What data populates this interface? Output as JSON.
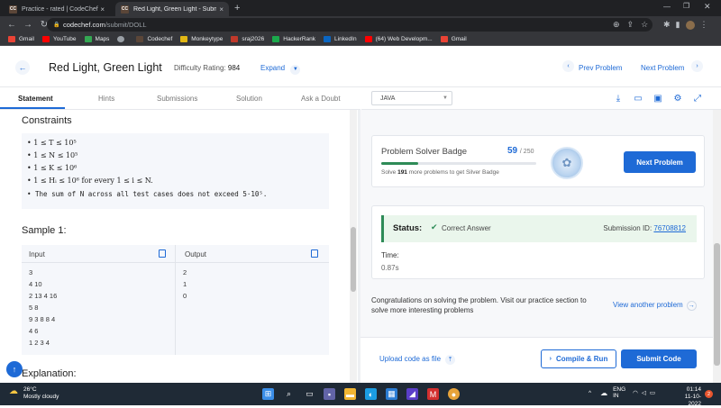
{
  "browser": {
    "tabs": [
      {
        "favicon": "CC",
        "title": "Practice - rated | CodeChef"
      },
      {
        "favicon": "CC",
        "title": "Red Light, Green Light - Submit |"
      }
    ],
    "url_domain": "codechef.com",
    "url_path": "/submit/DOLL",
    "bookmarks": [
      {
        "label": "Gmail",
        "color": "#ea4335"
      },
      {
        "label": "YouTube",
        "color": "#ff0000"
      },
      {
        "label": "Maps",
        "color": "#34a853"
      },
      {
        "label": "",
        "color": "#9aa0a6"
      },
      {
        "label": "Codechef",
        "color": "#5b4638"
      },
      {
        "label": "Monkeytype",
        "color": "#e2b714"
      },
      {
        "label": "sraj2026",
        "color": "#c0392b"
      },
      {
        "label": "HackerRank",
        "color": "#1ba94c"
      },
      {
        "label": "LinkedIn",
        "color": "#0a66c2"
      },
      {
        "label": "(64) Web Developm...",
        "color": "#ff0000"
      },
      {
        "label": "Gmail",
        "color": "#ea4335"
      }
    ]
  },
  "header": {
    "title": "Red Light, Green Light",
    "rating_label": "Difficulty Rating:",
    "rating_value": "984",
    "expand": "Expand",
    "prev": "Prev Problem",
    "next": "Next Problem"
  },
  "problem_tabs": [
    "Statement",
    "Hints",
    "Submissions",
    "Solution",
    "Ask a Doubt"
  ],
  "constraints": {
    "heading": "Constraints",
    "items": [
      "1 ≤ T ≤ 10⁵",
      "1 ≤ N ≤ 10⁵",
      "1 ≤ K ≤ 10⁶",
      "1 ≤ Hᵢ ≤ 10⁶ for every 1 ≤ i ≤ N.",
      "The sum of N across all test cases does not exceed 5·10⁵."
    ]
  },
  "sample": {
    "heading": "Sample 1:",
    "input_label": "Input",
    "output_label": "Output",
    "input_lines": [
      "3",
      "4 10",
      "2 13 4 16",
      "5 8",
      "9 3 8 8 4",
      "4 6",
      "1 2 3 4"
    ],
    "output_lines": [
      "2",
      "1",
      "0"
    ]
  },
  "explanation_heading": "Explanation:",
  "editor": {
    "language": "JAVA"
  },
  "badge": {
    "title": "Problem Solver Badge",
    "count": "59",
    "total": "/ 250",
    "progress": 0.236,
    "sub_prefix": "Solve",
    "sub_count": "191",
    "sub_suffix": "more problems to get Silver Badge",
    "next_button": "Next Problem"
  },
  "status": {
    "label": "Status:",
    "value": "Correct Answer",
    "submission_label": "Submission ID:",
    "submission_id": "76708812",
    "time_label": "Time:",
    "time_value": "0.87s"
  },
  "congrats": "Congratulations on solving the problem. Visit our practice section to solve more interesting problems",
  "view_another": "View another problem",
  "footer": {
    "upload": "Upload code as file",
    "compile": "Compile & Run",
    "submit": "Submit Code"
  },
  "taskbar": {
    "temp": "26°C",
    "weather": "Mostly cloudy",
    "lang1": "ENG",
    "lang2": "IN",
    "time": "01:14",
    "date": "11-10-2022",
    "notif_count": "2"
  },
  "colors": {
    "accent": "#1e6ad6",
    "success": "#2e8b57"
  }
}
